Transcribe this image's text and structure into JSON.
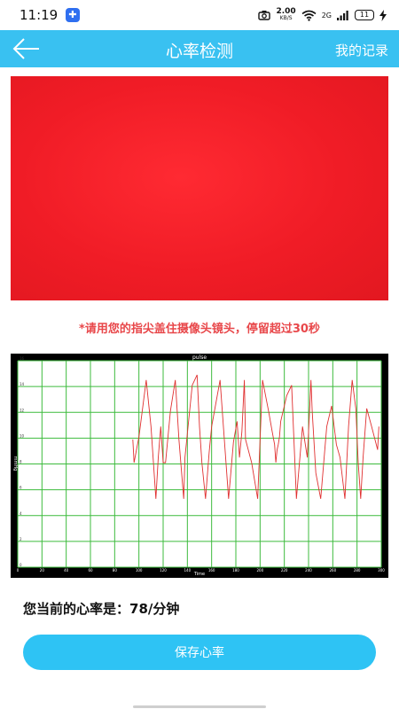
{
  "status_bar": {
    "time": "11:19",
    "net_speed_value": "2.00",
    "net_speed_unit": "KB/S",
    "signal_label": "2G",
    "battery_level": "11",
    "icons": [
      "camera-icon",
      "wifi-icon",
      "signal-icon",
      "battery-icon",
      "charging-icon"
    ]
  },
  "app_bar": {
    "title": "心率检测",
    "right_link": "我的记录",
    "back_icon": "arrow-left-icon",
    "color": "#39c1f1"
  },
  "hint": "*请用您的指尖盖住摄像头镜头，停留超过30秒",
  "chart_data": {
    "type": "line",
    "title": "pulse",
    "xlabel": "Time",
    "ylabel": "mmHg",
    "xlim": [
      0,
      300
    ],
    "ylim": [
      0,
      16
    ],
    "x_ticks": [
      0,
      20,
      40,
      60,
      80,
      100,
      120,
      140,
      160,
      180,
      200,
      220,
      240,
      260,
      280,
      300
    ],
    "y_ticks": [
      0,
      2,
      4,
      6,
      8,
      10,
      12,
      14,
      16
    ],
    "grid": true,
    "background": "#000000",
    "grid_color": "#3dbb3d",
    "line_color": "#e03030",
    "series": [
      {
        "x": [
          95,
          96,
          100,
          106,
          110,
          114,
          116,
          118,
          120,
          122,
          126,
          130,
          133,
          137,
          138,
          144,
          148,
          150,
          152,
          155,
          158,
          160,
          167,
          174,
          178,
          181,
          183,
          185,
          187,
          188,
          193,
          198,
          202,
          207,
          210,
          212,
          213,
          214,
          215,
          216,
          217,
          222,
          226,
          230,
          235,
          239,
          241,
          242,
          243,
          246,
          250,
          255,
          259,
          263,
          266,
          270,
          273,
          276,
          279,
          281,
          283,
          285,
          288,
          292,
          297,
          298
        ],
        "y": [
          9.9,
          8.1,
          10.1,
          14.5,
          10.9,
          5.3,
          8.5,
          10.9,
          8.1,
          8.1,
          12.1,
          14.5,
          9.9,
          5.3,
          8.5,
          14.1,
          14.9,
          10.9,
          8.1,
          5.3,
          8.9,
          10.9,
          14.5,
          5.3,
          9.7,
          11.3,
          8.5,
          10.5,
          14.5,
          9.9,
          8.1,
          5.3,
          14.5,
          12.1,
          10.5,
          9.5,
          8.1,
          9.1,
          9.5,
          10.1,
          11.3,
          13.3,
          14.1,
          5.3,
          10.9,
          8.5,
          12.5,
          14.5,
          12.1,
          7.3,
          5.3,
          10.9,
          12.5,
          9.5,
          8.5,
          5.3,
          10.9,
          14.5,
          12.3,
          8.1,
          5.3,
          8.5,
          12.3,
          10.9,
          9.1,
          10.9
        ]
      }
    ]
  },
  "heart_rate": {
    "label": "您当前的心率是：",
    "value": "78/分钟"
  },
  "save_button": "保存心率"
}
